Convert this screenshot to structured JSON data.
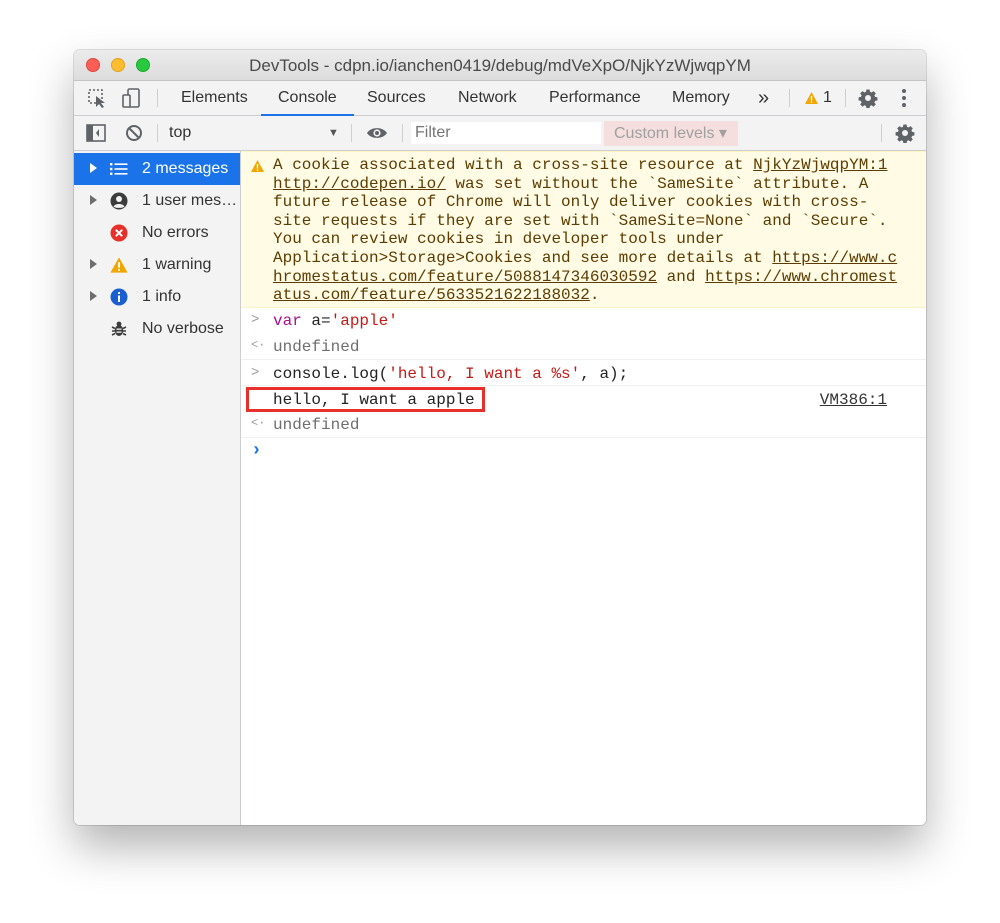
{
  "window": {
    "title": "DevTools - cdpn.io/ianchen0419/debug/mdVeXpO/NjkYzWjwqpYM"
  },
  "tabs": {
    "items": [
      "Elements",
      "Console",
      "Sources",
      "Network",
      "Performance",
      "Memory"
    ],
    "active": "Console",
    "more_label": "»",
    "warning_count": "1"
  },
  "toolbar": {
    "context": "top",
    "filter_placeholder": "Filter",
    "levels_label": "Custom levels ▾"
  },
  "sidebar": {
    "items": [
      {
        "label": "2 messages",
        "icon": "list-icon",
        "expandable": true,
        "selected": true
      },
      {
        "label": "1 user mes…",
        "icon": "user-icon",
        "expandable": true,
        "selected": false
      },
      {
        "label": "No errors",
        "icon": "error-icon",
        "expandable": false,
        "selected": false
      },
      {
        "label": "1 warning",
        "icon": "warning-icon",
        "expandable": true,
        "selected": false
      },
      {
        "label": "1 info",
        "icon": "info-icon",
        "expandable": true,
        "selected": false
      },
      {
        "label": "No verbose",
        "icon": "bug-icon",
        "expandable": false,
        "selected": false
      }
    ]
  },
  "console": {
    "warning": {
      "line1": "A cookie associated with a cross-site resource at ",
      "source": "NjkYzWjwqpYM:1",
      "link1": "http://codepen.io/",
      "line2_rest": " was set without the `SameSite` attribute. A",
      "line3": "future release of Chrome will only deliver cookies with cross-",
      "line4": "site requests if they are set with `SameSite=None` and `Secure`.",
      "line5": "You can review cookies in developer tools under",
      "line6_start": "Application>Storage>Cookies and see more details at ",
      "link2_a": "https://www.c",
      "link2_b": "hromestatus.com/feature/5088147346030592",
      "mid": " and ",
      "link3_a": "https://www.chromest",
      "link3_b": "atus.com/feature/5633521622188032",
      "end": "."
    },
    "input1": {
      "keyword": "var",
      "rest1": " a=",
      "string": "'apple'"
    },
    "result1": "undefined",
    "input2": {
      "pre": "console.log(",
      "string": "'hello, I want a %s'",
      "post": ", a);"
    },
    "log_output": "hello, I want a apple",
    "log_source": "VM386:1",
    "result2": "undefined",
    "prompt_symbol": "›",
    "input_prompt_symbol": ">",
    "result_symbol": "<·"
  }
}
